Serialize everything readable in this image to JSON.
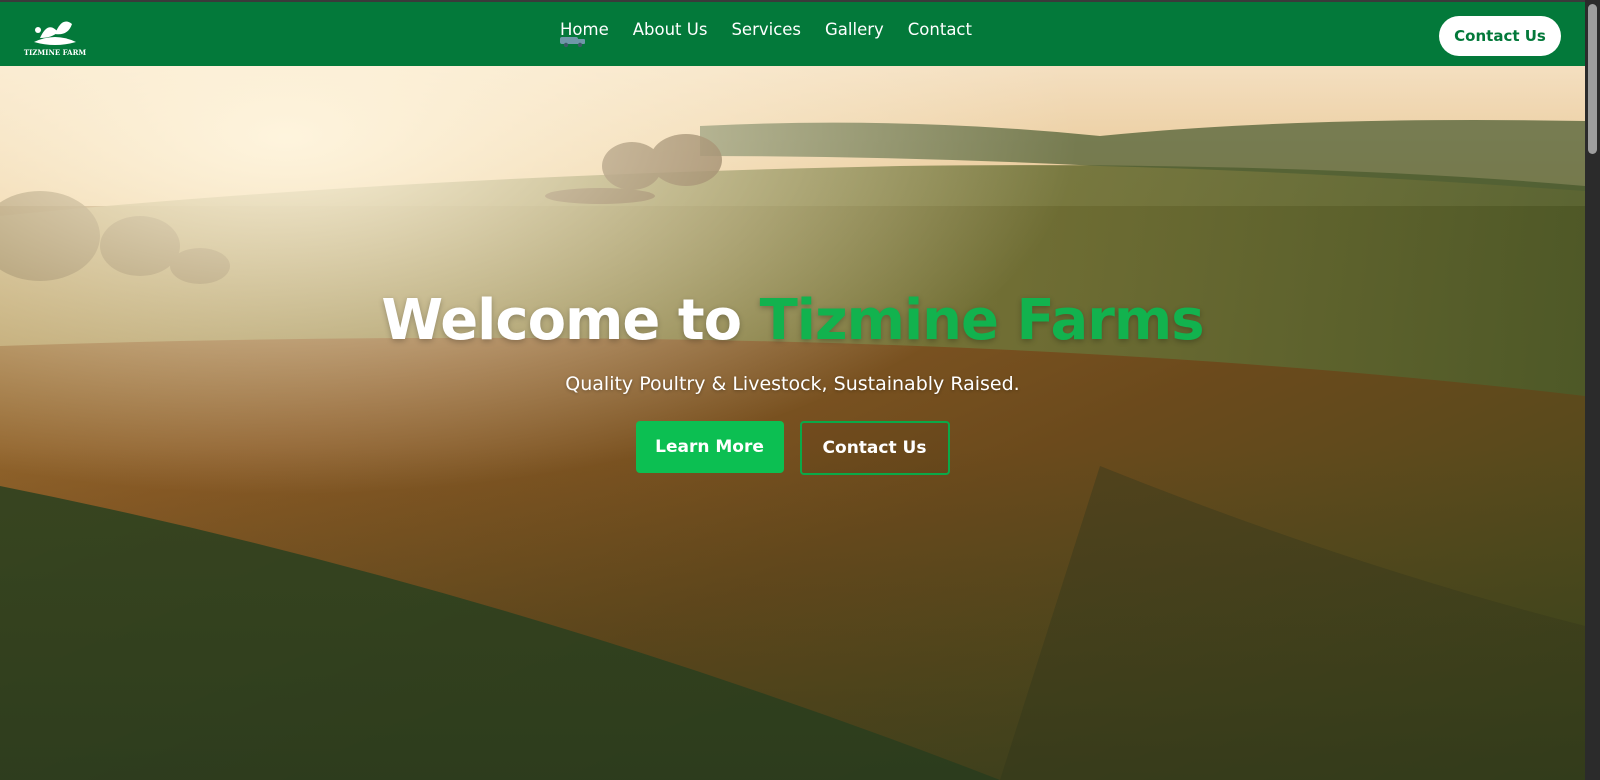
{
  "brand": {
    "name": "TIZMINE FARM",
    "logo_icon": "farm-leaves-logo"
  },
  "nav": {
    "items": [
      "Home",
      "About Us",
      "Services",
      "Gallery",
      "Contact"
    ]
  },
  "header": {
    "cta_label": "Contact Us"
  },
  "hero": {
    "title_plain": "Welcome to",
    "title_accent": "Tizmine Farms",
    "subtitle": "Quality Poultry & Livestock, Sustainably Raised.",
    "primary_button": "Learn More",
    "secondary_button": "Contact Us"
  },
  "colors": {
    "header_bg": "#03793a",
    "accent_green": "#12b24e",
    "button_green": "#0cbf52",
    "text_white": "#ffffff"
  }
}
